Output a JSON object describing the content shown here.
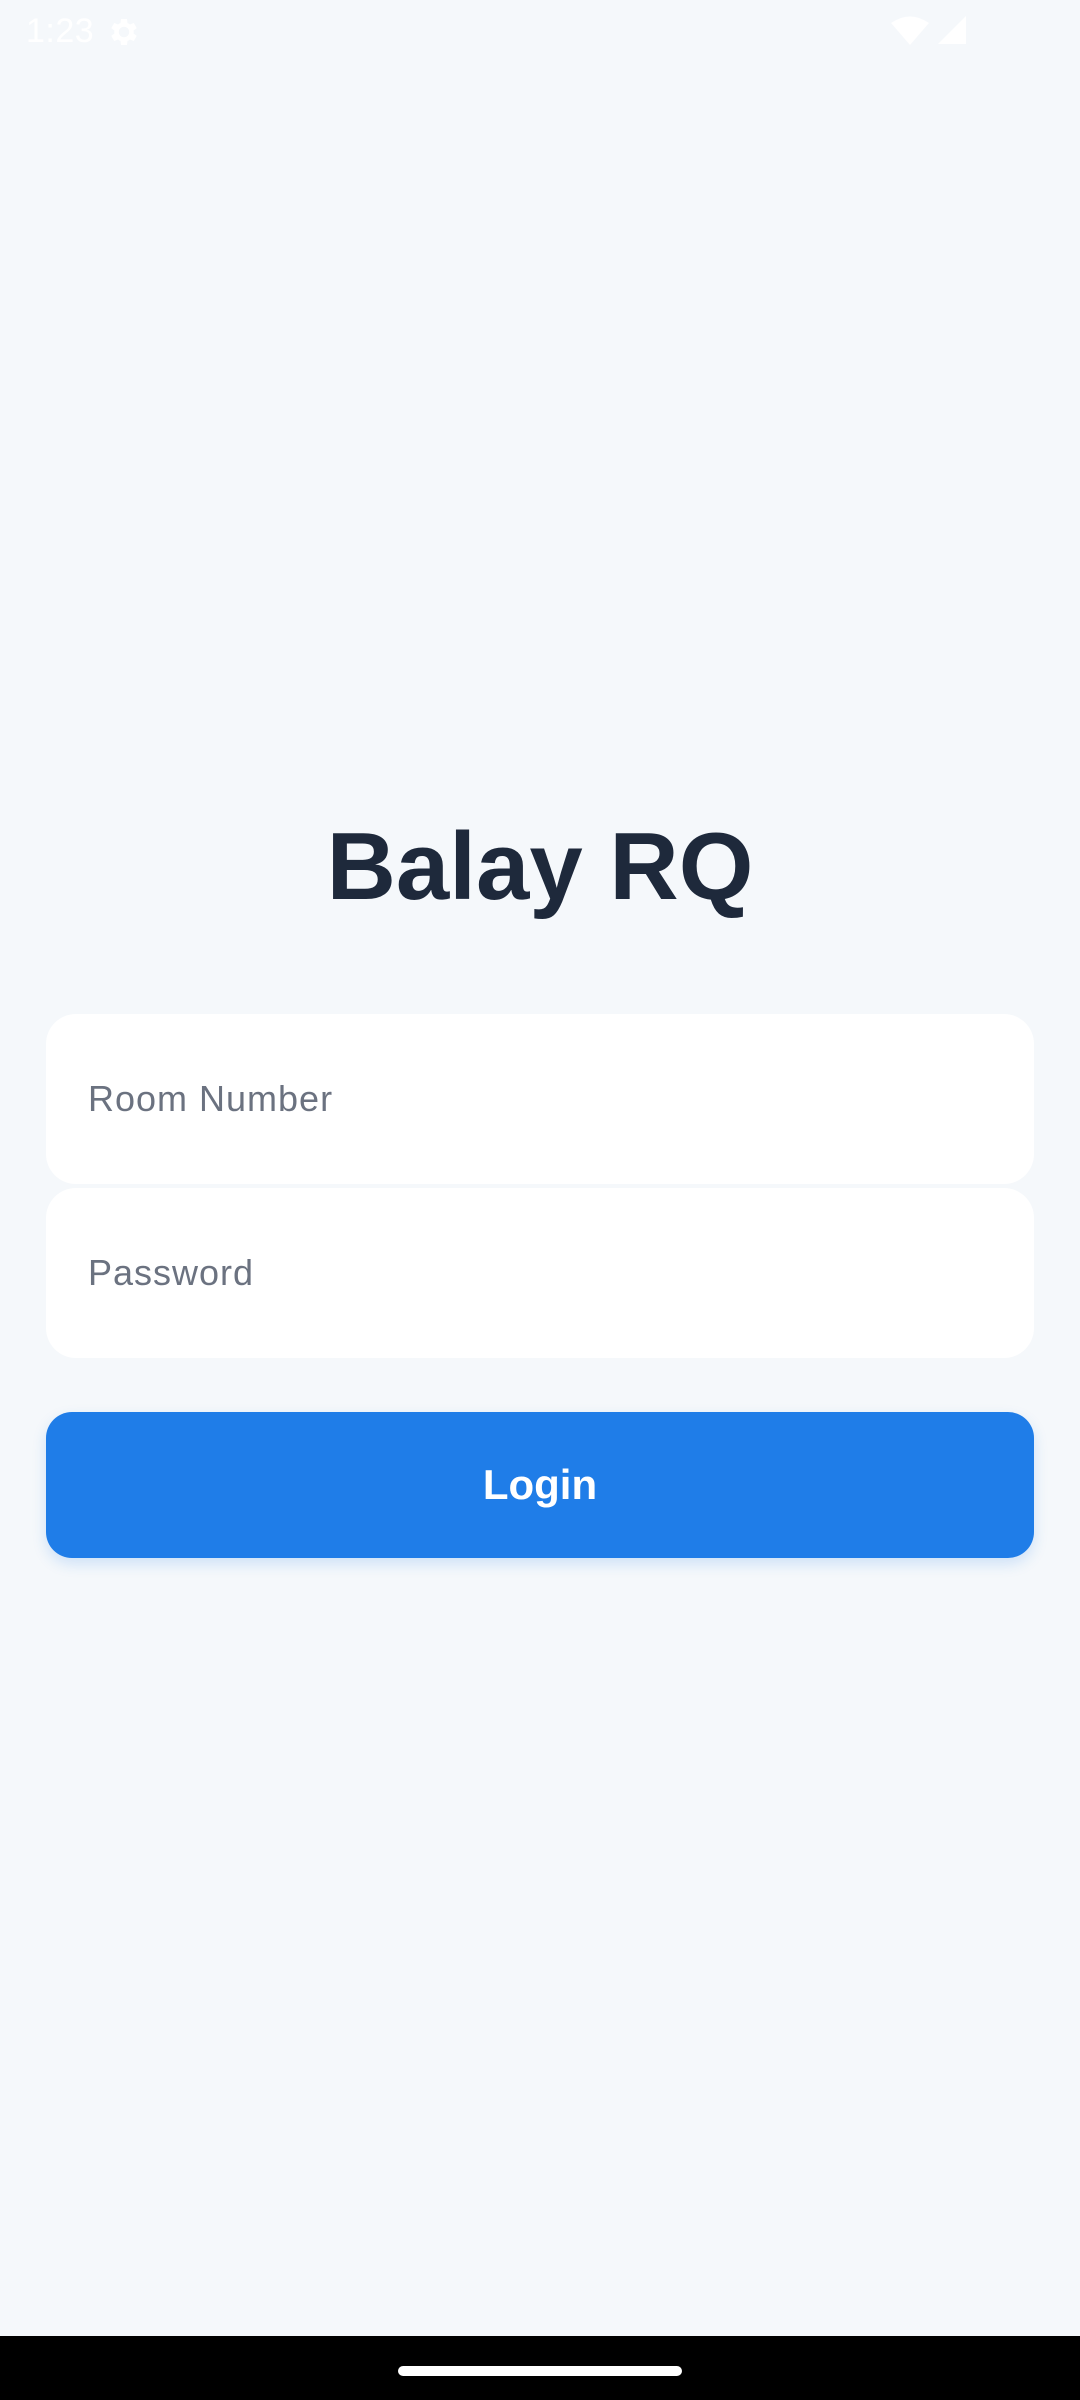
{
  "status_bar": {
    "time": "1:23",
    "icons": [
      "gear-icon",
      "wifi-icon",
      "signal-icon"
    ]
  },
  "app": {
    "title": "Balay RQ"
  },
  "form": {
    "room_number": {
      "placeholder": "Room Number",
      "value": ""
    },
    "password": {
      "placeholder": "Password",
      "value": ""
    },
    "login_label": "Login"
  },
  "colors": {
    "background": "#f5f8fb",
    "title": "#1e293b",
    "accent": "#1f7de8",
    "placeholder": "#6b7280"
  }
}
